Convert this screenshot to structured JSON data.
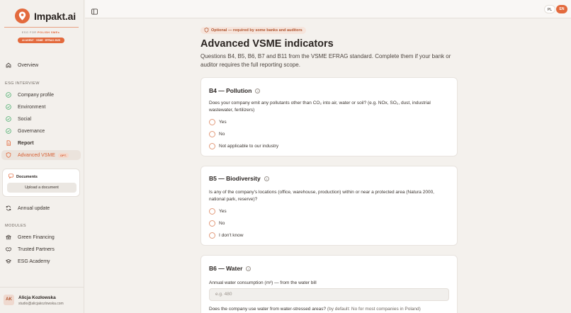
{
  "brand": {
    "name": "Impakt.ai",
    "tagline_prefix": "ESG FOR",
    "tagline_highlight": "POLISH SMEs",
    "badge": "AI AGENT · VSME · EFRAG 2025",
    "accent": "#e36a3d"
  },
  "sidebar": {
    "overview": "Overview",
    "esg_section": "ESG INTERVIEW",
    "esg_items": [
      {
        "label": "Company profile",
        "icon": "check-circle-icon"
      },
      {
        "label": "Environment",
        "icon": "check-circle-icon"
      },
      {
        "label": "Social",
        "icon": "check-circle-icon"
      },
      {
        "label": "Governance",
        "icon": "check-circle-icon"
      },
      {
        "label": "Report",
        "icon": "document-icon"
      },
      {
        "label": "Advanced VSME",
        "icon": "shield-icon",
        "tag": "OPT."
      }
    ],
    "documents": {
      "title": "Documents",
      "upload_label": "Upload a document"
    },
    "annual_update": "Annual update",
    "modules_section": "MODULES",
    "modules": [
      {
        "label": "Green Financing",
        "icon": "bank-icon"
      },
      {
        "label": "Trusted Partners",
        "icon": "handshake-icon"
      },
      {
        "label": "ESG Academy",
        "icon": "graduation-cap-icon"
      }
    ],
    "user": {
      "initials": "AK",
      "name": "Alicja Kozłowska",
      "email": "studio@alicjakozlowska.com"
    }
  },
  "topbar": {
    "lang_pl": "PL",
    "lang_en": "EN"
  },
  "main": {
    "optional_pill": "Optional — required by some banks and auditors",
    "title": "Advanced VSME indicators",
    "description": "Questions B4, B5, B6, B7 and B11 from the VSME EFRAG standard. Complete them if your bank or auditor requires the full reporting scope.",
    "b4": {
      "title": "B4 — Pollution",
      "question": "Does your company emit any pollutants other than CO₂ into air, water or soil? (e.g. NOx, SO₂, dust, industrial wastewater, fertilizers)",
      "options": [
        "Yes",
        "No",
        "Not applicable to our industry"
      ]
    },
    "b5": {
      "title": "B5 — Biodiversity",
      "question": "Is any of the company's locations (office, warehouse, production) within or near a protected area (Natura 2000, national park, reserve)?",
      "options": [
        "Yes",
        "No",
        "I don't know"
      ]
    },
    "b6": {
      "title": "B6 — Water",
      "consumption_label": "Annual water consumption (m³) — from the water bill",
      "consumption_placeholder": "e.g. 480",
      "stress_question": "Does the company use water from water-stressed areas?",
      "stress_hint": "(by default: No for most companies in Poland)"
    }
  }
}
